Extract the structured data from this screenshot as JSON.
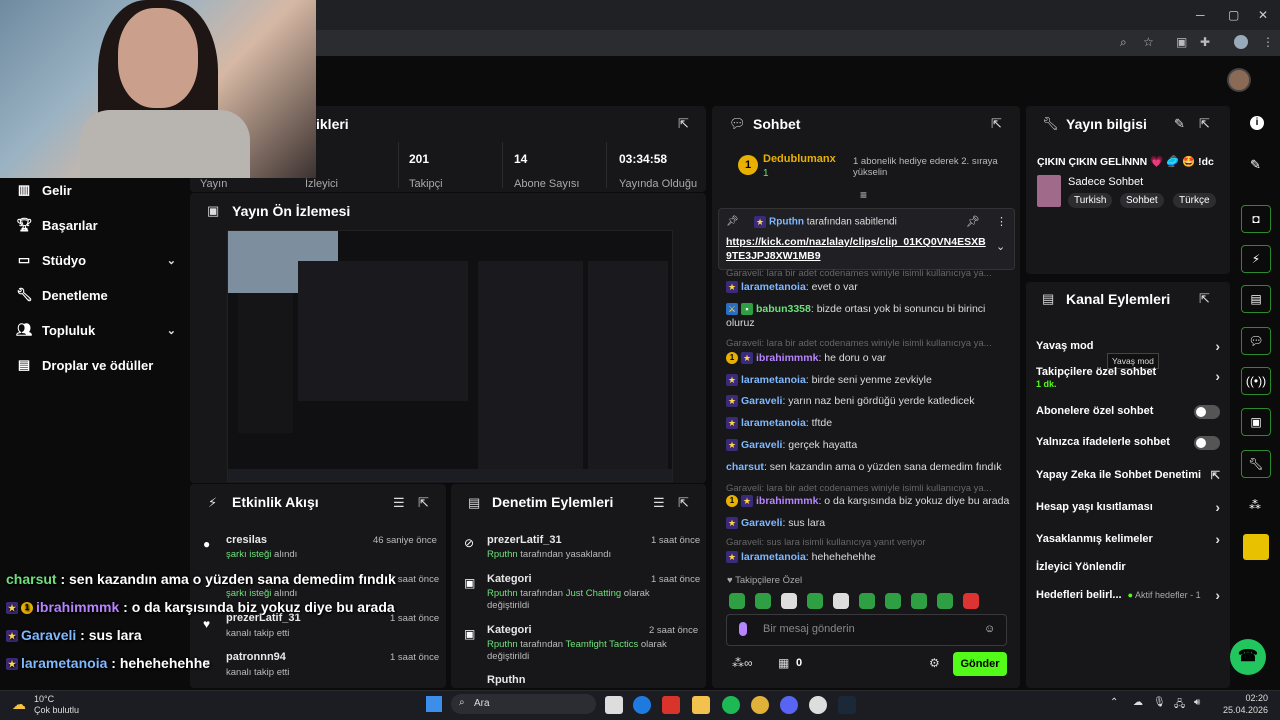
{
  "browser": {
    "min": "─",
    "max": "▢",
    "close": "✕"
  },
  "header": {
    "avatar": "avatar"
  },
  "sidebar": {
    "items": [
      {
        "label": "Gelir",
        "icon": "bank-icon"
      },
      {
        "label": "Başarılar",
        "icon": "trophy-icon"
      },
      {
        "label": "Stüdyo",
        "icon": "tv-icon"
      },
      {
        "label": "Denetleme",
        "icon": "wrench-icon"
      },
      {
        "label": "Topluluk",
        "icon": "people-icon"
      },
      {
        "label": "Droplar ve ödüller",
        "icon": "gift-icon"
      }
    ]
  },
  "stats": {
    "title": "ikleri",
    "items": [
      {
        "value": "",
        "label": "Yayın"
      },
      {
        "value": "",
        "label": "İzleyici"
      },
      {
        "value": "201",
        "label": "Takipçi"
      },
      {
        "value": "14",
        "label": "Abone Sayısı"
      },
      {
        "value": "03:34:58",
        "label": "Yayında Olduğu"
      }
    ]
  },
  "preview": {
    "title": "Yayın Ön İzlemesi"
  },
  "activity": {
    "title": "Etkinlik Akışı",
    "items": [
      {
        "user": "cresilas",
        "sub": "şarkı isteği",
        "sub2": " alındı",
        "time": "46 saniye önce"
      },
      {
        "user": "",
        "sub": "şarkı isteği",
        "sub2": " alındı",
        "time": "1 saat önce"
      },
      {
        "user": "prezerLatif_31",
        "sub": "kanalı takip etti",
        "sub2": "",
        "time": "1 saat önce"
      },
      {
        "user": "patronnn94",
        "sub": "kanalı takip etti",
        "sub2": "",
        "time": "1 saat önce"
      }
    ]
  },
  "moderation": {
    "title": "Denetim Eylemleri",
    "items": [
      {
        "title": "prezerLatif_31",
        "line1a": "Rputhn",
        "line1b": " tarafından yasaklandı",
        "line1c": "",
        "line1d": "",
        "time": "1 saat önce"
      },
      {
        "title": "Kategori",
        "line1a": "Rputhn",
        "line1b": " tarafından ",
        "line1c": "Just Chatting",
        "line1d": " olarak değiştirildi",
        "time": "1 saat önce"
      },
      {
        "title": "Kategori",
        "line1a": "Rputhn",
        "line1b": " tarafından ",
        "line1c": "Teamfight Tactics",
        "line1d": " olarak değiştirildi",
        "time": "2 saat önce"
      },
      {
        "title": "Rputhn",
        "line1a": "",
        "line1b": "",
        "line1c": "",
        "line1d": "",
        "time": ""
      }
    ]
  },
  "chat": {
    "title": "Sohbet",
    "gift": {
      "user": "Dedublumanx",
      "count": "1",
      "text": "1 abonelik hediye ederek 2. sıraya yükselin"
    },
    "pinned": {
      "by": "Rputhn",
      "text": " tarafından sabitlendi",
      "link": "https://kick.com/nazlalay/clips/clip_01KQ0VN4ESXB9TE3JPJ8XW1MB9"
    },
    "messages": [
      {
        "reply": "Garaveli: lara bir adet codenames winiyle isimli kullanıcıya ya...",
        "user": "larametanoia",
        "color": "u-blue",
        "text": "evet o var"
      },
      {
        "reply": "",
        "user": "babun3358",
        "color": "u-green",
        "text": "bizde ortası yok bi sonuncu bi birinci oluruz"
      },
      {
        "reply": "Garaveli: lara bir adet codenames winiyle isimli kullanıcıya ya...",
        "user": "ibrahimmmk",
        "color": "u-purple",
        "text": "he doru o var"
      },
      {
        "reply": "",
        "user": "larametanoia",
        "color": "u-blue",
        "text": "birde seni yenme zevkiyle"
      },
      {
        "reply": "",
        "user": "Garaveli",
        "color": "u-blue",
        "text": "yarın naz beni gördüğü yerde katledicek"
      },
      {
        "reply": "",
        "user": "larametanoia",
        "color": "u-blue",
        "text": "tftde"
      },
      {
        "reply": "",
        "user": "Garaveli",
        "color": "u-blue",
        "text": "gerçek hayatta"
      },
      {
        "reply": "",
        "user": "charsut",
        "color": "u-blue",
        "text": "sen kazandın ama o yüzden sana demedim fındık"
      },
      {
        "reply": "Garaveli: lara bir adet codenames winiyle isimli kullanıcıya ya...",
        "user": "ibrahimmmk",
        "color": "u-purple",
        "text": "o da karşısında biz yokuz diye bu arada"
      },
      {
        "reply": "",
        "user": "Garaveli",
        "color": "u-blue",
        "text": "sus lara"
      },
      {
        "reply": "Garaveli: sus lara isimli kullanıcıya yanıt veriyor",
        "user": "larametanoia",
        "color": "u-blue",
        "text": "hehehehehhe"
      }
    ],
    "followers_only": "Takipçilere Özel",
    "input_placeholder": "Bir mesaj gönderin",
    "count": "0",
    "send": "Gönder"
  },
  "stream_info": {
    "title": "Yayın bilgisi",
    "stream_title": "ÇIKIN ÇIKIN GELİNNN 💗 🥏 🤩 !dc",
    "category": "Sadece Sohbet",
    "tags": [
      "Turkish",
      "Sohbet",
      "Türkçe"
    ]
  },
  "channel_actions": {
    "title": "Kanal Eylemleri",
    "tooltip": "Yavaş mod",
    "items": [
      {
        "label": "Yavaş mod",
        "extra": "",
        "kind": "chevron"
      },
      {
        "label": "Takipçilere özel sohbet",
        "extra": "1 dk.",
        "kind": "chevron"
      },
      {
        "label": "Abonelere özel sohbet",
        "extra": "",
        "kind": "toggle"
      },
      {
        "label": "Yalnızca ifadelerle sohbet",
        "extra": "",
        "kind": "toggle"
      },
      {
        "label": "Yapay Zeka ile Sohbet Denetimi",
        "extra": "",
        "kind": "external"
      },
      {
        "label": "Hesap yaşı kısıtlaması",
        "extra": "",
        "kind": "chevron"
      },
      {
        "label": "Yasaklanmış kelimeler",
        "extra": "",
        "kind": "chevron"
      },
      {
        "label": "İzleyici Yönlendir",
        "extra": "",
        "kind": "none"
      },
      {
        "label": "Hedefleri belirl...",
        "extra": "Aktif hedefler - 1",
        "kind": "chevron"
      }
    ]
  },
  "overlay": [
    {
      "user": "charsut",
      "text": " : sen kazandın ama o yüzden sana demedim fındık",
      "color": "#6ee07a"
    },
    {
      "user": "ibrahimmmk",
      "text": " : o da karşısında biz yokuz diye bu arada",
      "color": "#b784ff"
    },
    {
      "user": "Garaveli",
      "text": " : sus lara",
      "color": "#7fb8ff"
    },
    {
      "user": "larametanoia",
      "text": " : hehehehehhe",
      "color": "#7fb8ff"
    }
  ],
  "taskbar": {
    "weather_temp": "10°C",
    "weather_desc": "Çok bulutlu",
    "search": "Ara",
    "time": "02:20",
    "date": "25.04.2026"
  }
}
